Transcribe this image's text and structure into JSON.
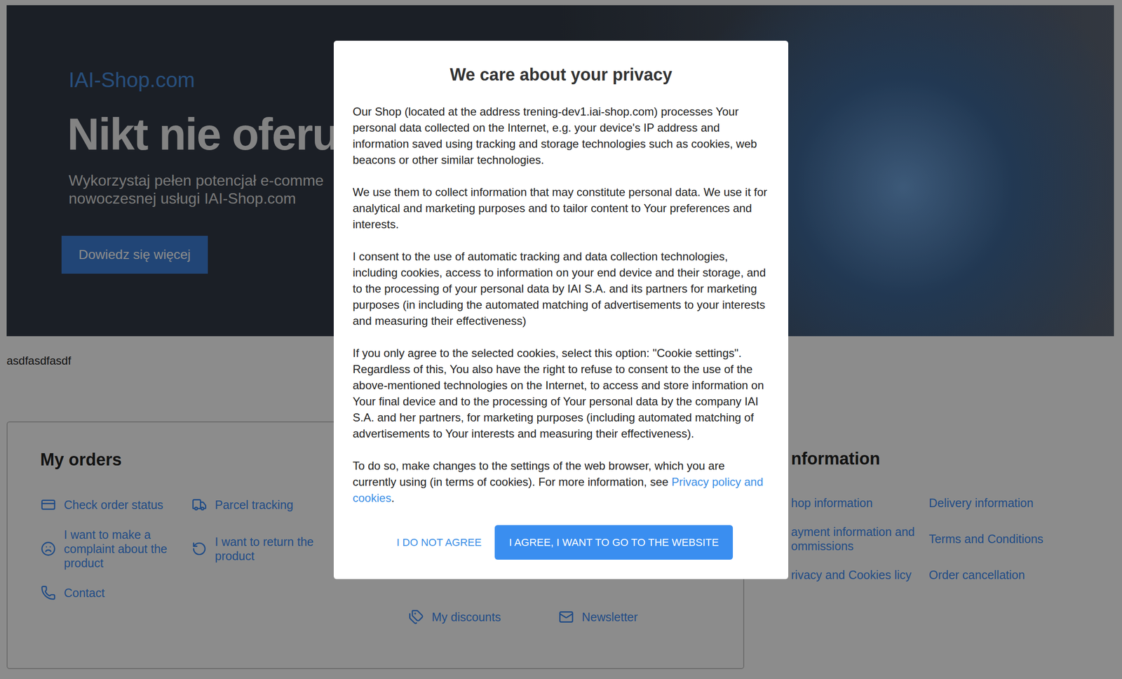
{
  "banner": {
    "brand": "IAI-Shop.com",
    "headline": "Nikt nie oferuje",
    "subtitle_lines": [
      "Wykorzystaj pełen potencjał e-comme",
      "nowoczesnej usługi IAI-Shop.com"
    ],
    "button": "Dowiedz się więcej"
  },
  "note": "asdfasdfasdf",
  "orders": {
    "title": "My orders",
    "items": [
      "Check order status",
      "Parcel tracking",
      "I want to make a complaint about the product",
      "I want to return the product",
      "Contact"
    ]
  },
  "account": {
    "items": [
      "My discounts",
      "Newsletter"
    ]
  },
  "information": {
    "title": "nformation",
    "items": [
      "hop information",
      "Delivery information",
      "ayment information and ommissions",
      "Terms and Conditions",
      "rivacy and Cookies licy",
      "Order cancellation"
    ]
  },
  "consent_dialog": {
    "title": "We care about your privacy",
    "paragraphs": [
      "Our Shop (located at the address trening-dev1.iai-shop.com) processes Your personal data collected on the Internet, e.g. your device's IP address and information saved using tracking and storage technologies such as cookies, web beacons or other similar technologies.",
      "We use them to collect information that may constitute personal data. We use it for analytical and marketing purposes and to tailor content to Your preferences and interests.",
      "I consent to the use of automatic tracking and data collection technologies, including cookies, access to information on your end device and their storage, and to the processing of your personal data by IAI S.A. and its partners for marketing purposes (in including the automated matching of advertisements to your interests and measuring their effectiveness)",
      "If you only agree to the selected cookies, select this option: \"Cookie settings\". Regardless of this, You also have the right to refuse to consent to the use of the above-mentioned technologies on the Internet, to access and store information on Your final device and to the processing of Your personal data by the company IAI S.A. and her partners, for marketing purposes (including automated matching of advertisements to Your interests and measuring their effectiveness)."
    ],
    "closing": {
      "text": "To do so, make changes to the settings of the web browser, which you are currently using (in terms of cookies). For more information, see ",
      "link": "Privacy policy and cookies",
      "after": "."
    },
    "buttons": [
      {
        "label": "I DO NOT AGREE",
        "kind": "text"
      },
      {
        "label": "I AGREE, I WANT TO GO TO THE WEBSITE",
        "kind": "filled"
      }
    ]
  }
}
